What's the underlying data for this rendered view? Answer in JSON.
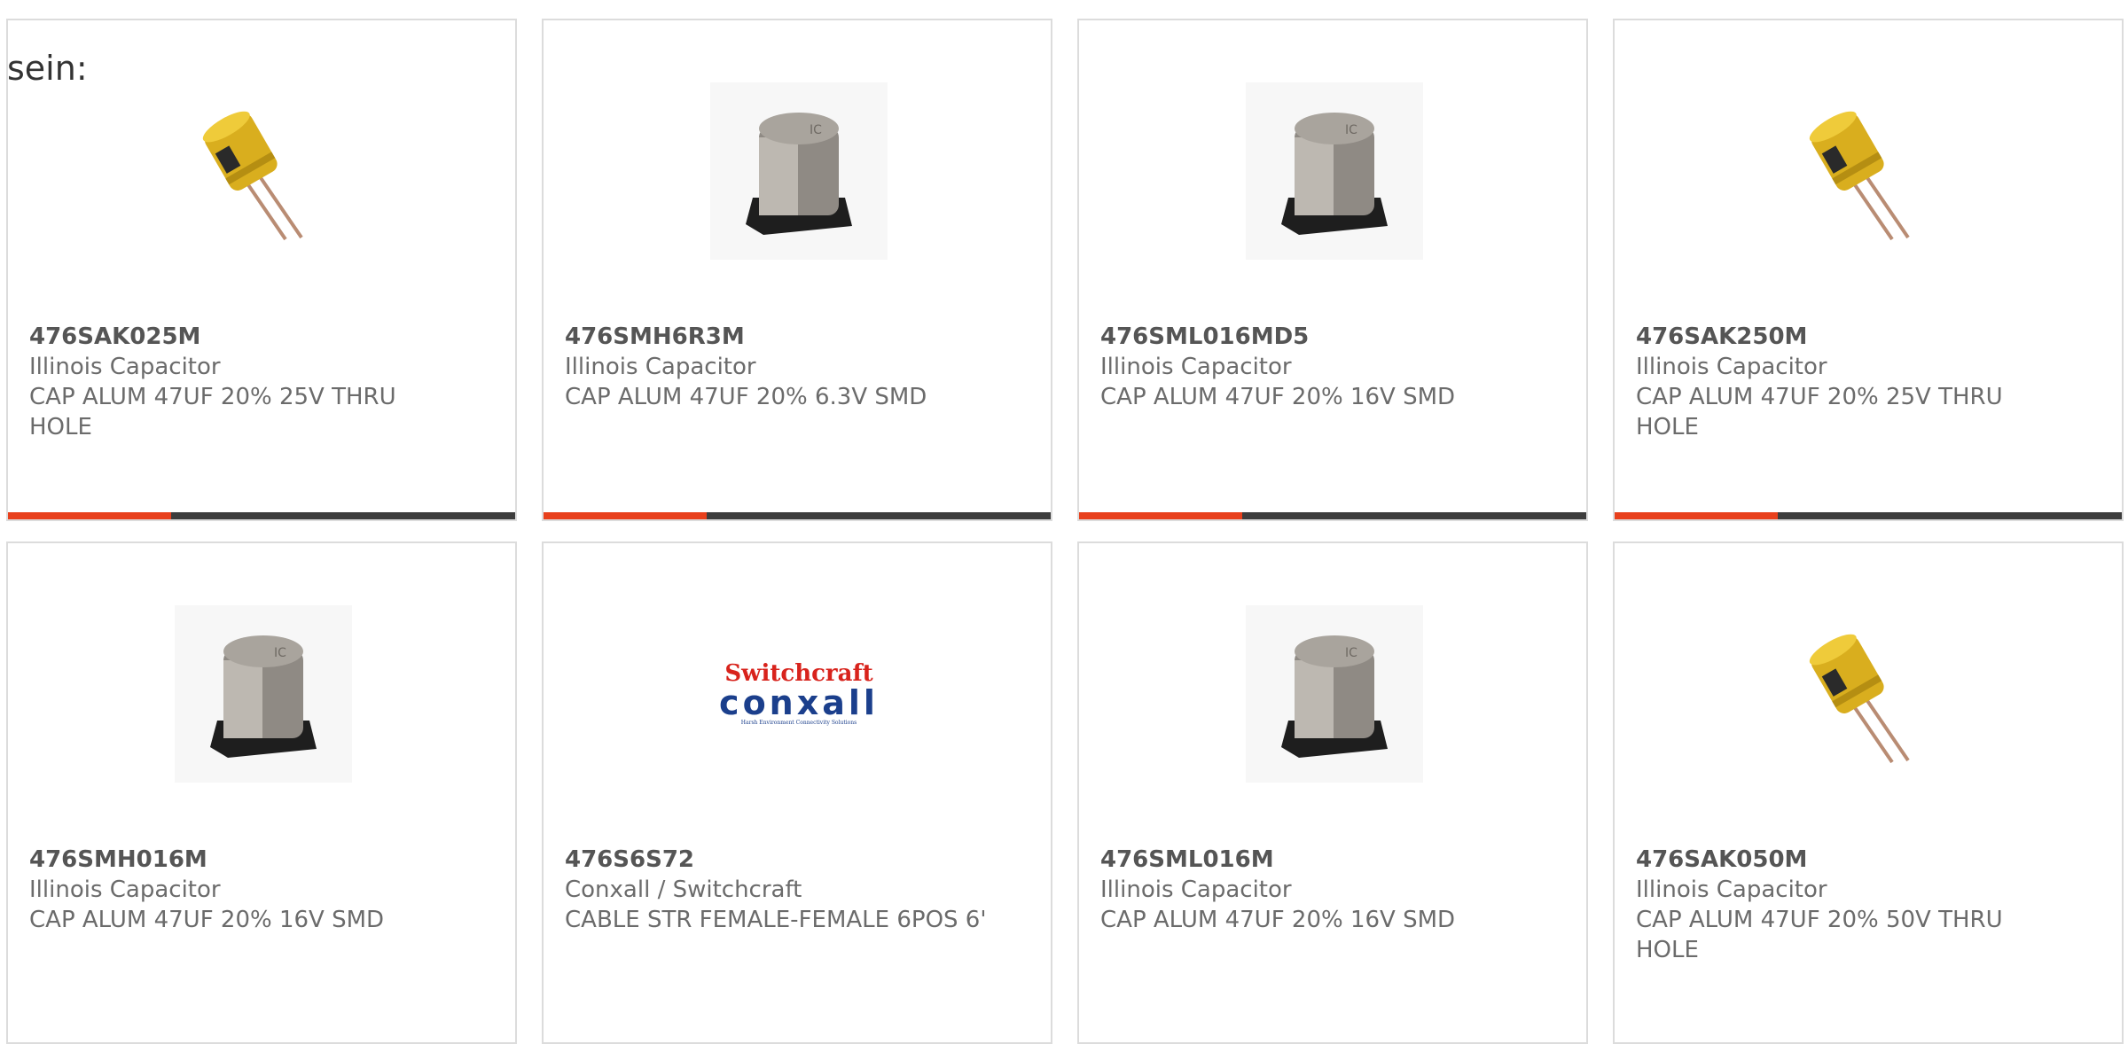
{
  "intro_text": "sein:",
  "colors": {
    "accent": "#e8401c",
    "bar": "#3d3d3d",
    "border": "#dcdcdc"
  },
  "cards": [
    {
      "part": "476SAK025M",
      "mfr": "Illinois Capacitor",
      "desc": "CAP ALUM 47UF 20% 25V THRU HOLE",
      "image": "radial-capacitor-icon"
    },
    {
      "part": "476SMH6R3M",
      "mfr": "Illinois Capacitor",
      "desc": "CAP ALUM 47UF 20% 6.3V SMD",
      "image": "smd-capacitor-icon"
    },
    {
      "part": "476SML016MD5",
      "mfr": "Illinois Capacitor",
      "desc": "CAP ALUM 47UF 20% 16V SMD",
      "image": "smd-capacitor-icon"
    },
    {
      "part": "476SAK250M",
      "mfr": "Illinois Capacitor",
      "desc": "CAP ALUM 47UF 20% 25V THRU HOLE",
      "image": "radial-capacitor-icon"
    },
    {
      "part": "476SMH016M",
      "mfr": "Illinois Capacitor",
      "desc": "CAP ALUM 47UF 20% 16V SMD",
      "image": "smd-capacitor-icon"
    },
    {
      "part": "476S6S72",
      "mfr": "Conxall / Switchcraft",
      "desc": "CABLE STR FEMALE-FEMALE 6POS 6'",
      "image": "switchcraft-conxall-logo",
      "logo": {
        "top": "Switchcraft",
        "mid": "conxall",
        "sub": "Harsh Environment Connectivity Solutions"
      }
    },
    {
      "part": "476SML016M",
      "mfr": "Illinois Capacitor",
      "desc": "CAP ALUM 47UF 20% 16V SMD",
      "image": "smd-capacitor-icon"
    },
    {
      "part": "476SAK050M",
      "mfr": "Illinois Capacitor",
      "desc": "CAP ALUM 47UF 20% 50V THRU HOLE",
      "image": "radial-capacitor-icon"
    }
  ]
}
